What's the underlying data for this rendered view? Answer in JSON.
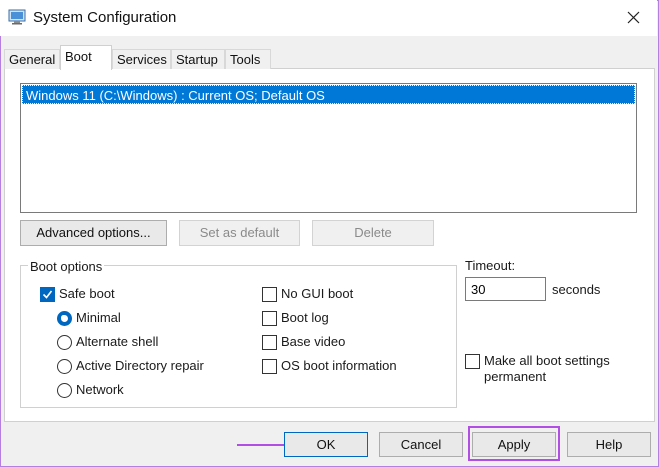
{
  "window": {
    "title": "System Configuration",
    "icon": "system-configuration-icon",
    "close_icon": "close-icon"
  },
  "tabs": [
    {
      "label": "General",
      "active": false
    },
    {
      "label": "Boot",
      "active": true
    },
    {
      "label": "Services",
      "active": false
    },
    {
      "label": "Startup",
      "active": false
    },
    {
      "label": "Tools",
      "active": false
    }
  ],
  "boot_list": {
    "items": [
      {
        "label": "Windows 11 (C:\\Windows) : Current OS; Default OS",
        "selected": true
      }
    ]
  },
  "list_buttons": {
    "advanced": "Advanced options...",
    "set_default": "Set as default",
    "delete": "Delete"
  },
  "boot_options": {
    "group_label": "Boot options",
    "safe_boot": {
      "label": "Safe boot",
      "checked": true
    },
    "safe_modes": [
      {
        "label": "Minimal",
        "checked": true
      },
      {
        "label": "Alternate shell",
        "checked": false
      },
      {
        "label": "Active Directory repair",
        "checked": false
      },
      {
        "label": "Network",
        "checked": false
      }
    ],
    "right_options": [
      {
        "label": "No GUI boot",
        "checked": false
      },
      {
        "label": "Boot log",
        "checked": false
      },
      {
        "label": "Base video",
        "checked": false
      },
      {
        "label": "OS boot information",
        "checked": false
      }
    ]
  },
  "timeout": {
    "label": "Timeout:",
    "value": "30",
    "unit": "seconds"
  },
  "make_permanent": {
    "label": "Make all boot settings permanent",
    "checked": false
  },
  "dialog_buttons": {
    "ok": "OK",
    "cancel": "Cancel",
    "apply": "Apply",
    "help": "Help"
  },
  "annotations": {
    "highlight_color": "#b14fe4",
    "arrow_color": "#b14fe4"
  },
  "colors": {
    "selection": "#0078d7",
    "accent": "#0067c0"
  }
}
